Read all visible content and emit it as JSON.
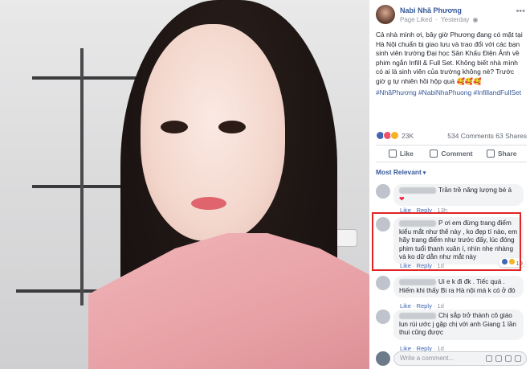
{
  "post": {
    "page_name": "Nabi Nhã Phương",
    "page_status": "Page Liked",
    "time": "Yesterday",
    "text": "Cả nhà mình ơi, bây giờ Phương đang có mặt tại Hà Nội chuẩn bị giao lưu và trao đổi với các bạn sinh viên trường Đại học Sân Khấu Điện Ảnh về phim ngắn Infill & Full Set. Không biết nhà mình có ai là sinh viên của trường không nè? Trước giờ g tự nhiên hồi hộp quá 🥰🥰🥰",
    "hashtags": "#NhãPhương #NabiNhaPhuong #InfillandFullSet"
  },
  "stats": {
    "reactions_count": "23K",
    "comments": "534 Comments",
    "shares": "63 Shares"
  },
  "actions": {
    "like": "Like",
    "comment": "Comment",
    "share": "Share"
  },
  "sort": {
    "label": "Most Relevant"
  },
  "comments": [
    {
      "text": "Trần trề năng lượng bé á",
      "like": "Like",
      "reply": "Reply",
      "time": "13h"
    },
    {
      "text": "P ơi em đừng trang điểm kiểu mắt như thế này , ko đẹp tí nào, em hãy trang điểm như trước đấy, lúc đóng phim tuổi thanh xuân í, nhìn nhẹ nhàng và ko dữ dằn như mắt này",
      "like": "Like",
      "reply": "Reply",
      "time": "1d",
      "reaction_count": "19"
    },
    {
      "text": "Ui e k đi đk . Tiếc quá . Hiếm khi thấy Bi ra Hà nội mà k có ở đó",
      "like": "Like",
      "reply": "Reply",
      "time": "1d"
    },
    {
      "text": "Chị sắp trở thành cô giáo lun rùi ước j gặp chị với anh Giang 1 lần thui cũng được",
      "like": "Like",
      "reply": "Reply",
      "time": "1d"
    }
  ],
  "composer": {
    "placeholder": "Write a comment..."
  },
  "colors": {
    "link_blue": "#365899",
    "highlight_red": "#e02424"
  }
}
